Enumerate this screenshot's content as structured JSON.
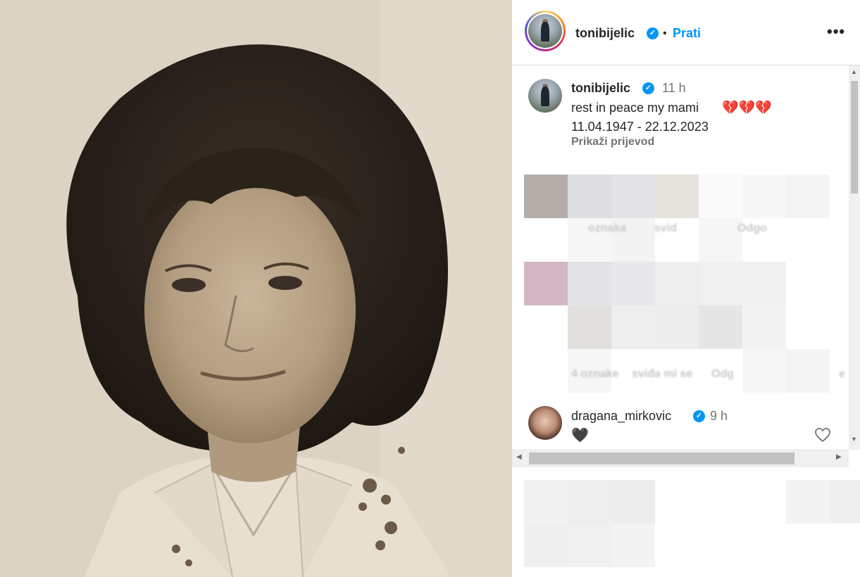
{
  "header": {
    "username": "tonibijelic",
    "separator": "•",
    "follow_label": "Prati",
    "more_label": "•••"
  },
  "post": {
    "username": "tonibijelic",
    "time": "11 h",
    "caption": "rest in peace my mami",
    "hearts": "💔💔💔",
    "dates": "11.04.1947 - 22.12.2023",
    "translate_label": "Prikaži prijevod"
  },
  "blurred": {
    "likes_1": "oznaka",
    "like_1": "svid",
    "reply_1": "Odgo",
    "likes_2": "4 oznake",
    "like_2": "sviđa mi se",
    "reply_2": "Odg",
    "trail_2": "e"
  },
  "comments": [
    {
      "username": "dragana_mirkovic",
      "time": "9 h",
      "text": "🖤"
    }
  ],
  "colors": {
    "accent": "#0095f6",
    "text": "#262626",
    "muted": "#737373"
  },
  "icons": {
    "verified": "verified-badge-icon",
    "heart": "heart-outline-icon",
    "more": "more-options-icon"
  }
}
